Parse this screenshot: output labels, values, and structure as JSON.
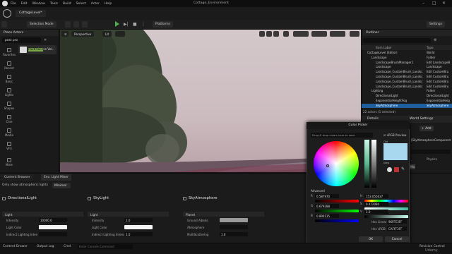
{
  "menu": [
    "File",
    "Edit",
    "Window",
    "Tools",
    "Build",
    "Select",
    "Actor",
    "Help"
  ],
  "project_name": "Cottage_Environment",
  "level_tab": "CottageLevel*",
  "toolbar": {
    "selection_mode": "Selection Mode",
    "platforms": "Platforms",
    "settings": "Settings"
  },
  "place_actors": {
    "title": "Place Actors",
    "search": "post pro",
    "item": "PostProcess Vol..",
    "item_highlight": "PostProce",
    "categories": [
      "Favorites",
      "Recent",
      "Basic",
      "Lights",
      "Shapes",
      "Cine",
      "Media",
      "VFX",
      "More"
    ]
  },
  "viewport": {
    "perspective": "Perspective",
    "lit": "Lit"
  },
  "outliner": {
    "title": "Outliner",
    "header_label": "Item Label",
    "header_type": "Type",
    "rows": [
      {
        "name": "CottageLevel (Editor)",
        "type": "World"
      },
      {
        "name": "Landscape",
        "type": "Folder"
      },
      {
        "name": "LandscapeBrushManager1",
        "type": "Edit LandscapeB"
      },
      {
        "name": "Landscape",
        "type": "Landscape"
      },
      {
        "name": "Landscape_CustomBrush_Landsc",
        "type": "Edit CustomBru"
      },
      {
        "name": "Landscape_CustomBrush_Landsc",
        "type": "Edit CustomBru"
      },
      {
        "name": "Landscape_CustomBrush_Landsc",
        "type": "Edit CustomBru"
      },
      {
        "name": "Landscape_CustomBrush_Landsc",
        "type": "Edit CustomBru"
      },
      {
        "name": "Lighting",
        "type": "Folder"
      },
      {
        "name": "DirectionalLight",
        "type": "DirectionalLight"
      },
      {
        "name": "ExponentialHeightFog",
        "type": "ExponentialHeig"
      },
      {
        "name": "SkyAtmosphere",
        "type": "SkyAtmosphere"
      }
    ],
    "count": "22 actors (1 selected)"
  },
  "details": {
    "title": "Details",
    "world_settings": "World Settings",
    "add": "Add",
    "component": "(SkyAtmosphereComponent",
    "physics": "Physics",
    "mo": "Mo",
    "v1": "0897",
    "v2": "4089"
  },
  "bottom_tabs": {
    "content_browser": "Content Browser",
    "env_light": "Env. Light Mixer"
  },
  "filter": {
    "label": "Only show atmospheric lights",
    "value": "Minimal"
  },
  "columns": [
    {
      "title": "DirectionalLight",
      "section": "Light",
      "props": [
        {
          "label": "Intensity",
          "value": "10000.0"
        },
        {
          "label": "Light Color",
          "value": ""
        },
        {
          "label": "Indirect Lighting Inten",
          "value": ""
        }
      ]
    },
    {
      "title": "SkyLight",
      "section": "Light",
      "props": [
        {
          "label": "Intensity",
          "value": "1.0"
        },
        {
          "label": "Light Color",
          "value": ""
        },
        {
          "label": "Indirect Lighting Intensity",
          "value": "1.0"
        }
      ]
    },
    {
      "title": "SkyAtmosphere",
      "section": "Planet",
      "props": [
        {
          "label": "Ground Albedo",
          "value": ""
        },
        {
          "label": "Atmosphere",
          "value": ""
        },
        {
          "label": "MultiScattering",
          "value": "1.0"
        }
      ]
    }
  ],
  "color_picker": {
    "title": "Color Picker",
    "hint": "Drag & drop colors here to save",
    "srgb": "sRGB Preview",
    "old": "Old",
    "new": "New",
    "advanced": "Advanced",
    "r": "0.587970",
    "g": "0.679288",
    "b": "0.890115",
    "h": "153.055637",
    "s": "0.472084",
    "v": "1.0",
    "hex_linear_label": "Hex Linear",
    "hex_linear": "96FFE3FF",
    "hex_srgb_label": "Hex sRGB",
    "hex_srgb": "CAFFF2FF",
    "ok": "OK",
    "cancel": "Cancel",
    "accent": "#a8d8f0"
  },
  "status": {
    "content_drawer": "Content Drawer",
    "output_log": "Output Log",
    "cmd": "Cmd",
    "cmd_placeholder": "Enter Console Command",
    "source_control": "Revision Control"
  },
  "watermark": "Udemy"
}
